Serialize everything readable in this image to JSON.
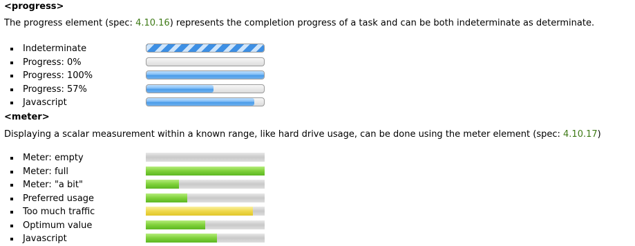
{
  "progress_section": {
    "heading": "<progress>",
    "desc_before": "The progress element (spec: ",
    "spec": "4.10.16",
    "desc_after": ") represents the completion progress of a task and can be both indeterminate as determinate.",
    "items": [
      {
        "label": "Indeterminate",
        "value": null
      },
      {
        "label": "Progress: 0%",
        "value": 0
      },
      {
        "label": "Progress: 100%",
        "value": 1
      },
      {
        "label": "Progress: 57%",
        "value": 0.57
      },
      {
        "label": "Javascript",
        "value": 0.92
      }
    ]
  },
  "meter_section": {
    "heading": "<meter>",
    "desc_before": "Displaying a scalar measurement within a known range, like hard drive usage, can be done using the meter element (spec: ",
    "spec": "4.10.17",
    "desc_after": ")",
    "items": [
      {
        "label": "Meter: empty",
        "value": 0,
        "state": "optimum"
      },
      {
        "label": "Meter: full",
        "value": 1,
        "state": "optimum"
      },
      {
        "label": "Meter: \"a bit\"",
        "value": 0.28,
        "state": "optimum"
      },
      {
        "label": "Preferred usage",
        "value": 0.35,
        "state": "optimum"
      },
      {
        "label": "Too much traffic",
        "value": 0.9,
        "state": "warning"
      },
      {
        "label": "Optimum value",
        "value": 0.5,
        "state": "optimum"
      },
      {
        "label": "Javascript",
        "value": 0.6,
        "state": "optimum"
      }
    ]
  },
  "colors": {
    "spec_link": "#3e7a16",
    "progress_fill": "#4a9be8",
    "meter_optimum": "#7fd13a",
    "meter_warning": "#efd94c"
  }
}
